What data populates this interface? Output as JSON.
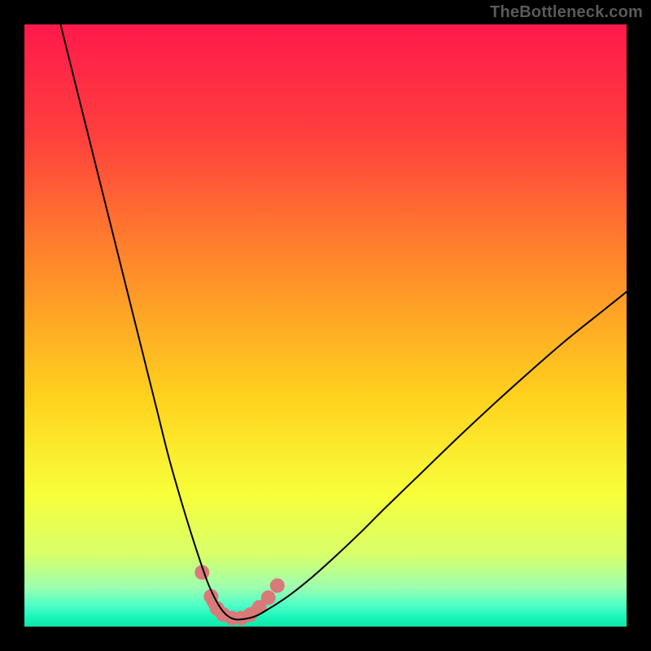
{
  "watermark": "TheBottleneck.com",
  "chart_data": {
    "type": "line",
    "title": "",
    "xlabel": "",
    "ylabel": "",
    "xlim": [
      0,
      100
    ],
    "ylim": [
      0,
      100
    ],
    "grid": false,
    "legend": false,
    "background_gradient_stops": [
      {
        "offset": 0.0,
        "color": "#ff1a4b"
      },
      {
        "offset": 0.18,
        "color": "#ff3e3e"
      },
      {
        "offset": 0.4,
        "color": "#ff8a2a"
      },
      {
        "offset": 0.62,
        "color": "#ffd21e"
      },
      {
        "offset": 0.78,
        "color": "#f7ff3a"
      },
      {
        "offset": 0.88,
        "color": "#d8ff6a"
      },
      {
        "offset": 0.935,
        "color": "#9dffb0"
      },
      {
        "offset": 0.965,
        "color": "#4dffc6"
      },
      {
        "offset": 0.985,
        "color": "#18f5b9"
      },
      {
        "offset": 1.0,
        "color": "#0fe6a8"
      }
    ],
    "series": [
      {
        "name": "bottleneck-curve",
        "color": "#000000",
        "stroke_width": 2.0,
        "x": [
          6.0,
          8.0,
          10.0,
          12.0,
          14.0,
          16.0,
          18.0,
          20.0,
          22.0,
          24.0,
          26.0,
          28.0,
          30.0,
          31.0,
          32.0,
          33.0,
          34.0,
          35.0,
          36.0,
          38.0,
          40.0,
          44.0,
          48.0,
          52.0,
          56.0,
          60.0,
          66.0,
          72.0,
          78.0,
          84.0,
          90.0,
          96.0,
          100.0
        ],
        "y": [
          100.0,
          92.0,
          84.0,
          76.0,
          68.0,
          60.0,
          52.0,
          44.0,
          36.0,
          28.0,
          21.0,
          14.5,
          8.5,
          6.0,
          4.0,
          2.5,
          1.6,
          1.2,
          1.2,
          1.6,
          2.6,
          5.2,
          8.4,
          12.0,
          15.8,
          19.8,
          25.6,
          31.4,
          37.0,
          42.4,
          47.6,
          52.4,
          55.6
        ]
      }
    ],
    "marker_sets": [
      {
        "name": "valley-markers",
        "color": "#d97a7a",
        "radius_px": 9,
        "points": [
          {
            "x": 29.5,
            "y": 9.0
          },
          {
            "x": 31.0,
            "y": 5.0
          },
          {
            "x": 32.0,
            "y": 3.0
          },
          {
            "x": 33.0,
            "y": 2.0
          },
          {
            "x": 34.5,
            "y": 1.4
          },
          {
            "x": 36.0,
            "y": 1.4
          },
          {
            "x": 37.5,
            "y": 2.0
          },
          {
            "x": 39.0,
            "y": 3.2
          },
          {
            "x": 40.5,
            "y": 4.8
          },
          {
            "x": 42.0,
            "y": 6.8
          }
        ]
      }
    ],
    "baseline_path": {
      "name": "valley-baseline",
      "color": "#d97a7a",
      "stroke_width_px": 12,
      "x": [
        31.0,
        32.0,
        33.0,
        34.0,
        35.0,
        36.0,
        37.0,
        38.0
      ],
      "y": [
        4.2,
        2.6,
        1.8,
        1.4,
        1.3,
        1.4,
        1.8,
        2.6
      ]
    }
  }
}
